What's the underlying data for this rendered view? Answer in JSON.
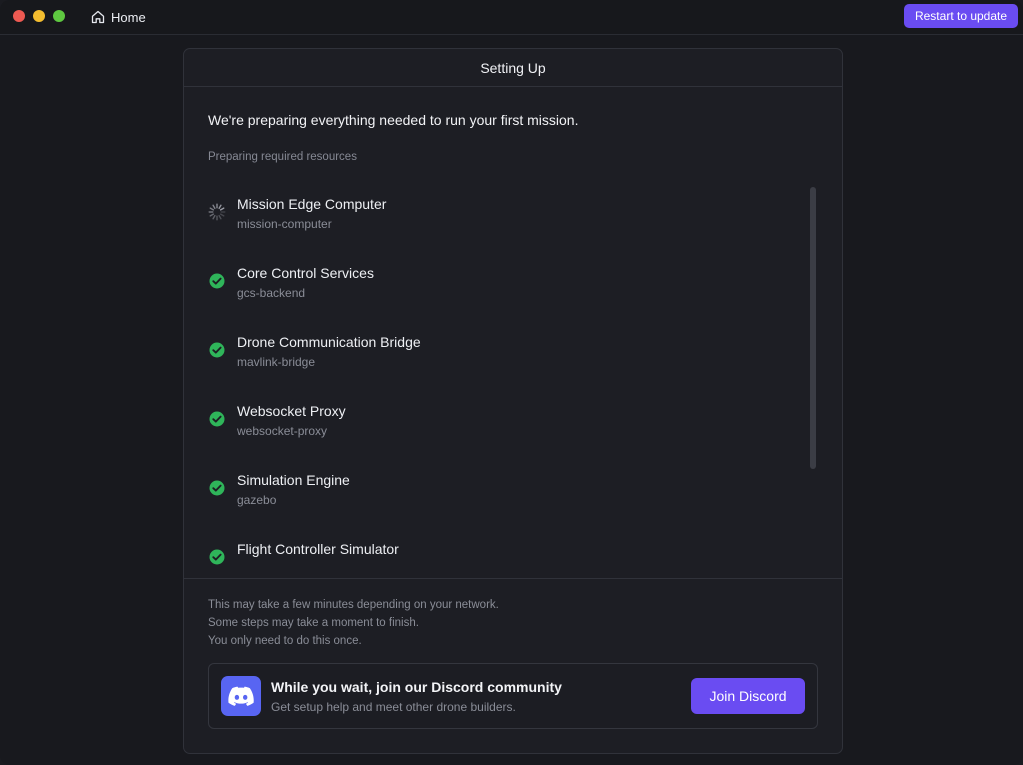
{
  "titlebar": {
    "home_label": "Home",
    "restart_label": "Restart to update",
    "accent_color": "#6a4cf2"
  },
  "panel": {
    "title": "Setting Up",
    "intro": "We're preparing everything needed to run your first mission.",
    "section_label": "Preparing required resources",
    "items": [
      {
        "title": "Mission Edge Computer",
        "subtitle": "mission-computer",
        "status": "loading"
      },
      {
        "title": "Core Control Services",
        "subtitle": "gcs-backend",
        "status": "done"
      },
      {
        "title": "Drone Communication Bridge",
        "subtitle": "mavlink-bridge",
        "status": "done"
      },
      {
        "title": "Websocket Proxy",
        "subtitle": "websocket-proxy",
        "status": "done"
      },
      {
        "title": "Simulation Engine",
        "subtitle": "gazebo",
        "status": "done"
      },
      {
        "title": "Flight Controller Simulator",
        "subtitle": "",
        "status": "done"
      }
    ],
    "notes": [
      "This may take a few minutes depending on your network.",
      "Some steps may take a moment to finish.",
      "You only need to do this once."
    ],
    "discord": {
      "title": "While you wait, join our Discord community",
      "subtitle": "Get setup help and meet other drone builders.",
      "button_label": "Join Discord",
      "brand_color": "#5865f2"
    },
    "status_colors": {
      "done": "#2fb55a",
      "loading": "#9a9ca5"
    }
  }
}
